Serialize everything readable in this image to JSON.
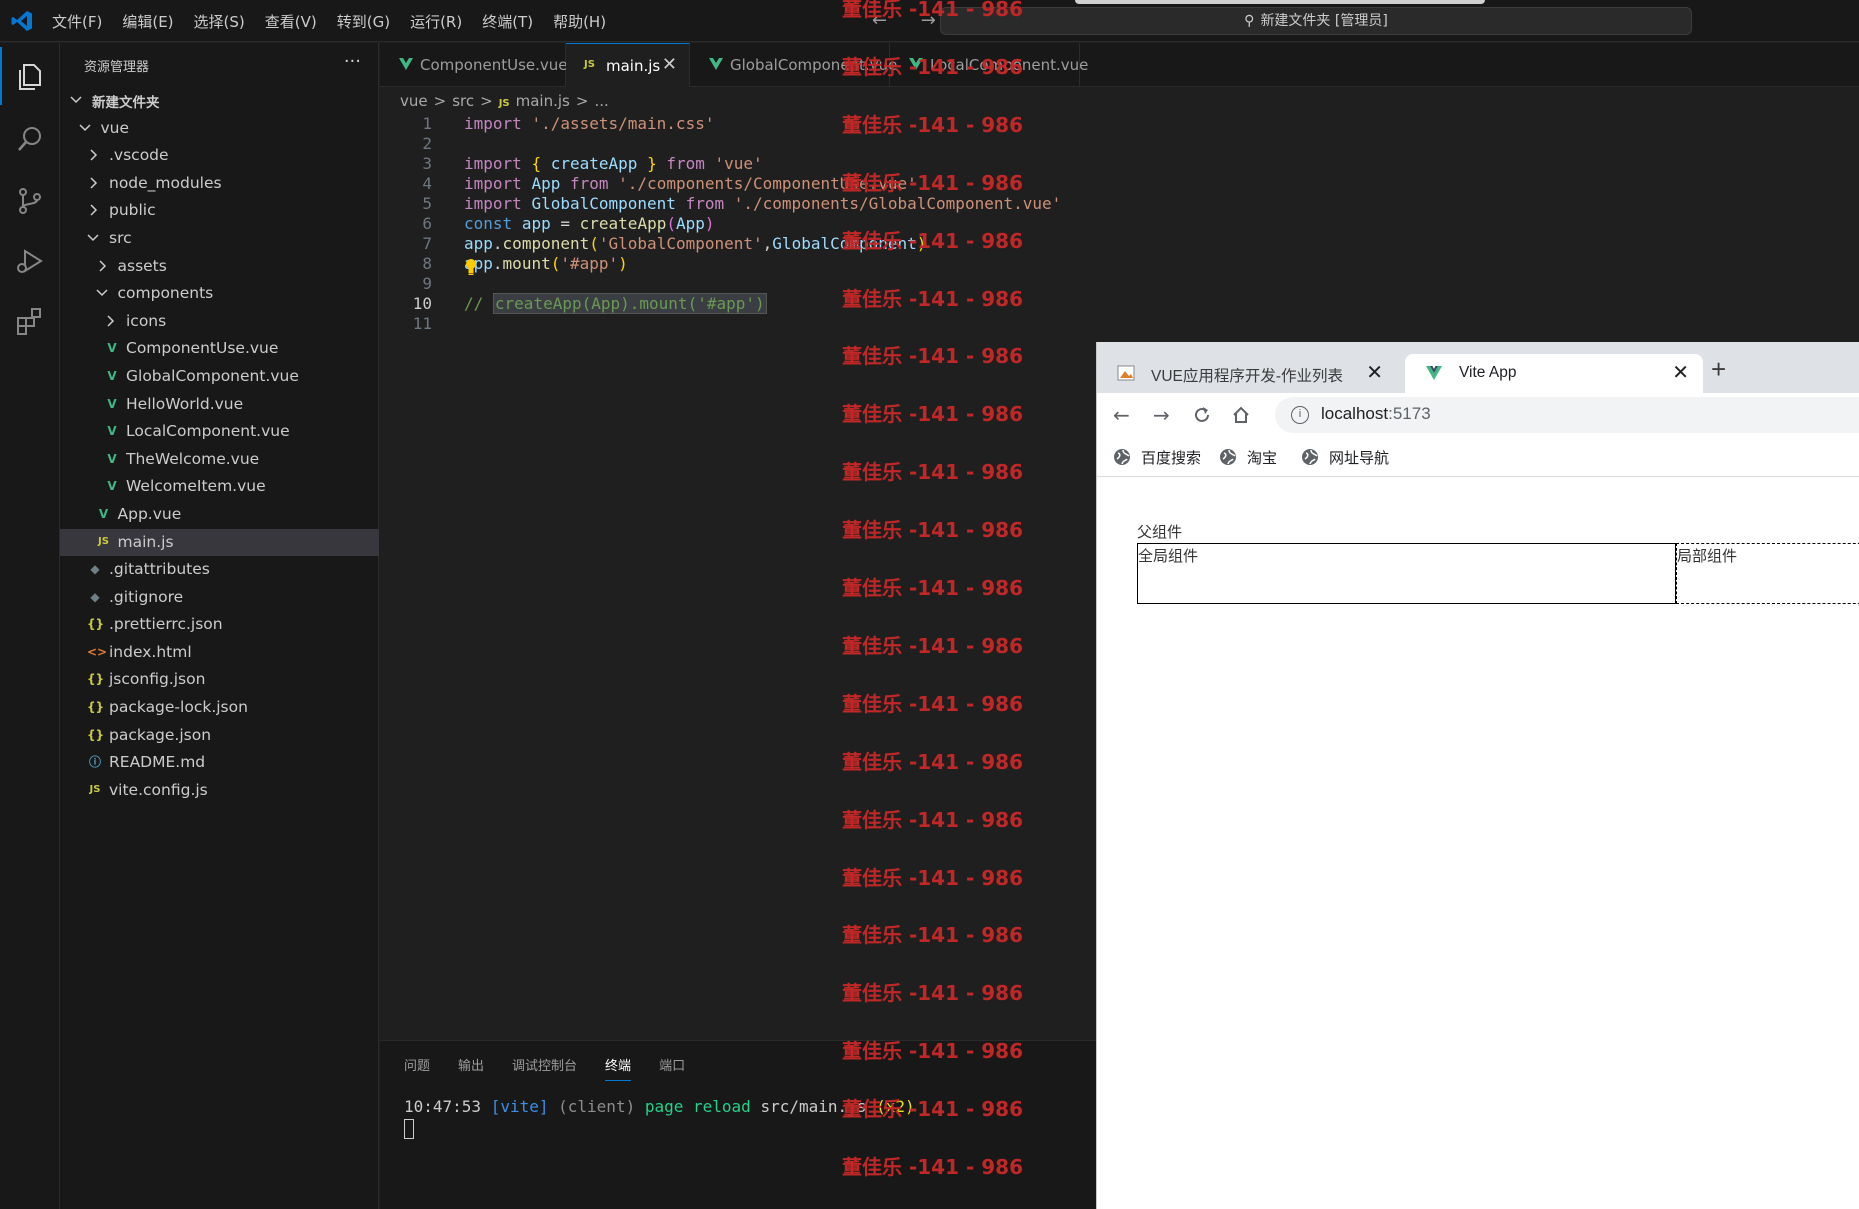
{
  "titlebar": {
    "menu": [
      "文件(F)",
      "编辑(E)",
      "选择(S)",
      "查看(V)",
      "转到(G)",
      "运行(R)",
      "终端(T)",
      "帮助(H)"
    ],
    "nav": "← →",
    "command_center": "新建文件夹 [管理员]"
  },
  "sidebar": {
    "title": "资源管理器",
    "more": "···",
    "tree": [
      {
        "label": "新建文件夹",
        "depth": 0,
        "type": "folder-open",
        "bold": true
      },
      {
        "label": "vue",
        "depth": 1,
        "type": "folder-open"
      },
      {
        "label": ".vscode",
        "depth": 2,
        "type": "folder"
      },
      {
        "label": "node_modules",
        "depth": 2,
        "type": "folder"
      },
      {
        "label": "public",
        "depth": 2,
        "type": "folder"
      },
      {
        "label": "src",
        "depth": 2,
        "type": "folder-open"
      },
      {
        "label": "assets",
        "depth": 3,
        "type": "folder"
      },
      {
        "label": "components",
        "depth": 3,
        "type": "folder-open"
      },
      {
        "label": "icons",
        "depth": 4,
        "type": "folder"
      },
      {
        "label": "ComponentUse.vue",
        "depth": 4,
        "type": "vue"
      },
      {
        "label": "GlobalComponent.vue",
        "depth": 4,
        "type": "vue"
      },
      {
        "label": "HelloWorld.vue",
        "depth": 4,
        "type": "vue"
      },
      {
        "label": "LocalComponent.vue",
        "depth": 4,
        "type": "vue"
      },
      {
        "label": "TheWelcome.vue",
        "depth": 4,
        "type": "vue"
      },
      {
        "label": "WelcomeItem.vue",
        "depth": 4,
        "type": "vue"
      },
      {
        "label": "App.vue",
        "depth": 3,
        "type": "vue"
      },
      {
        "label": "main.js",
        "depth": 3,
        "type": "js",
        "selected": true
      },
      {
        "label": ".gitattributes",
        "depth": 2,
        "type": "git"
      },
      {
        "label": ".gitignore",
        "depth": 2,
        "type": "git"
      },
      {
        "label": ".prettierrc.json",
        "depth": 2,
        "type": "json"
      },
      {
        "label": "index.html",
        "depth": 2,
        "type": "html"
      },
      {
        "label": "jsconfig.json",
        "depth": 2,
        "type": "json"
      },
      {
        "label": "package-lock.json",
        "depth": 2,
        "type": "json"
      },
      {
        "label": "package.json",
        "depth": 2,
        "type": "json"
      },
      {
        "label": "README.md",
        "depth": 2,
        "type": "info"
      },
      {
        "label": "vite.config.js",
        "depth": 2,
        "type": "js"
      }
    ]
  },
  "tabs": [
    {
      "label": "ComponentUse.vue",
      "type": "vue"
    },
    {
      "label": "main.js",
      "type": "js",
      "active": true,
      "close": "✕"
    },
    {
      "label": "GlobalComponent.vue",
      "type": "vue"
    },
    {
      "label": "LocalComponent.vue",
      "type": "vue"
    }
  ],
  "breadcrumb": [
    "vue",
    ">",
    "src",
    ">",
    "JS",
    "main.js",
    ">",
    "..."
  ],
  "editor": {
    "line_numbers": [
      "1",
      "2",
      "3",
      "4",
      "5",
      "6",
      "7",
      "8",
      "9",
      "10",
      "11"
    ],
    "current_line": "10",
    "lines": [
      "import './assets/main.css'",
      "",
      "import { createApp } from 'vue'",
      "import App from './components/ComponentUse.vue'",
      "import GlobalComponent from './components/GlobalComponent.vue'",
      "const app = createApp(App)",
      "app.component('GlobalComponent',GlobalComponent)",
      "app.mount('#app')",
      "",
      "// createApp(App).mount('#app')",
      ""
    ]
  },
  "panel": {
    "tabs": [
      "问题",
      "输出",
      "调试控制台",
      "终端",
      "端口"
    ],
    "active_tab": "终端",
    "terminal": {
      "time": "10:47:53",
      "tag": "[vite]",
      "client": "(client)",
      "msg": "page reload",
      "file": "src/main.js",
      "count": "(x2)"
    }
  },
  "watermark": "董佳乐 -141 - 986",
  "browser": {
    "tabs": [
      {
        "label": "VUE应用程序开发-作业列表",
        "close": "✕"
      },
      {
        "label": "Vite App",
        "close": "✕",
        "active": true
      }
    ],
    "new_tab": "+",
    "url_host": "localhost",
    "url_port": ":5173",
    "bookmarks": [
      "百度搜索",
      "淘宝",
      "网址导航"
    ],
    "page": {
      "parent_label": "父组件",
      "global_label": "全局组件",
      "local_label": "局部组件"
    }
  },
  "colors": {
    "accent": "#0078d4",
    "vue_green": "#41b883",
    "watermark": "#c22727"
  }
}
